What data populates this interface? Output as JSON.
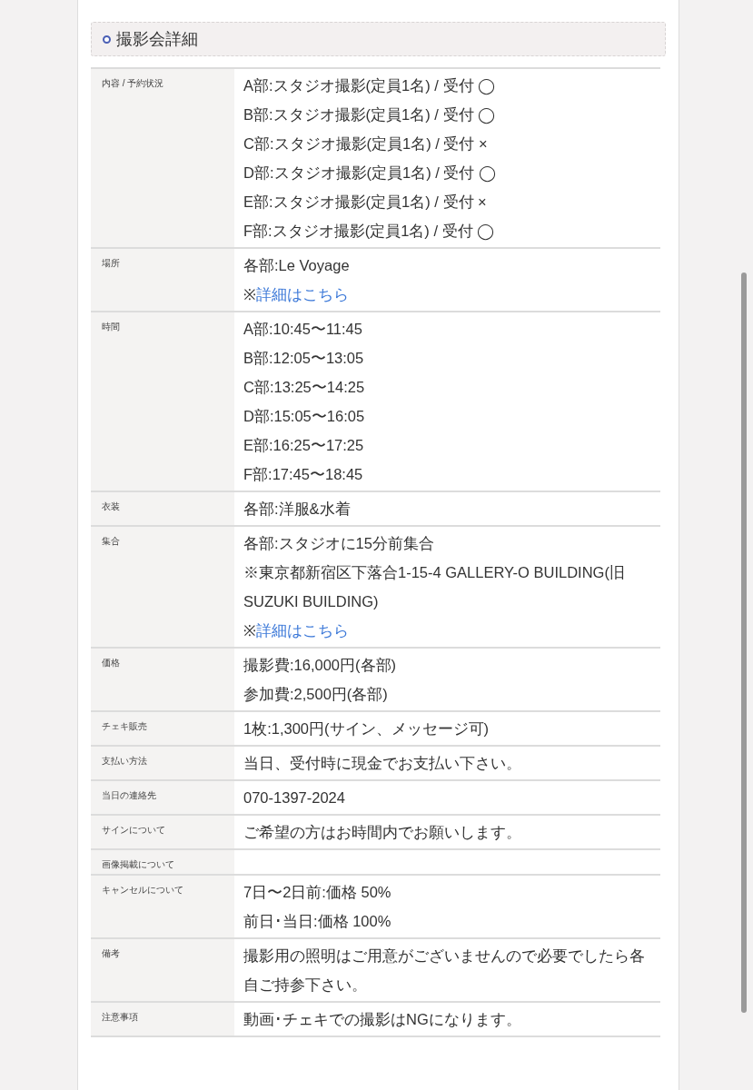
{
  "section": {
    "title": "撮影会詳細"
  },
  "rows": [
    {
      "label": "内容 / 予約状況",
      "lines": [
        {
          "kind": "text",
          "text": "A部:スタジオ撮影(定員1名) / 受付 ◯"
        },
        {
          "kind": "text",
          "text": "B部:スタジオ撮影(定員1名) / 受付 ◯"
        },
        {
          "kind": "text",
          "text": "C部:スタジオ撮影(定員1名) / 受付 ×"
        },
        {
          "kind": "text",
          "text": "D部:スタジオ撮影(定員1名) / 受付 ◯"
        },
        {
          "kind": "text",
          "text": "E部:スタジオ撮影(定員1名) / 受付 ×"
        },
        {
          "kind": "text",
          "text": "F部:スタジオ撮影(定員1名) / 受付 ◯"
        }
      ]
    },
    {
      "label": "場所",
      "lines": [
        {
          "kind": "text",
          "text": "各部:Le Voyage"
        },
        {
          "kind": "link",
          "prefix": "※",
          "text": "詳細はこちら"
        }
      ]
    },
    {
      "label": "時間",
      "lines": [
        {
          "kind": "text",
          "text": "A部:10:45〜11:45"
        },
        {
          "kind": "text",
          "text": "B部:12:05〜13:05"
        },
        {
          "kind": "text",
          "text": "C部:13:25〜14:25"
        },
        {
          "kind": "text",
          "text": "D部:15:05〜16:05"
        },
        {
          "kind": "text",
          "text": "E部:16:25〜17:25"
        },
        {
          "kind": "text",
          "text": "F部:17:45〜18:45"
        }
      ]
    },
    {
      "label": "衣装",
      "lines": [
        {
          "kind": "text",
          "text": "各部:洋服&水着"
        }
      ]
    },
    {
      "label": "集合",
      "lines": [
        {
          "kind": "text",
          "text": "各部:スタジオに15分前集合"
        },
        {
          "kind": "text",
          "text": "※東京都新宿区下落合1-15-4 GALLERY-O BUILDING(旧SUZUKI BUILDING)"
        },
        {
          "kind": "link",
          "prefix": "※",
          "text": "詳細はこちら"
        }
      ]
    },
    {
      "label": "価格",
      "lines": [
        {
          "kind": "text",
          "text": "撮影費:16,000円(各部)"
        },
        {
          "kind": "text",
          "text": "参加費:2,500円(各部)"
        }
      ]
    },
    {
      "label": "チェキ販売",
      "lines": [
        {
          "kind": "text",
          "text": "1枚:1,300円(サイン、メッセージ可)"
        }
      ]
    },
    {
      "label": "支払い方法",
      "lines": [
        {
          "kind": "text",
          "text": "当日、受付時に現金でお支払い下さい。"
        }
      ]
    },
    {
      "label": "当日の連絡先",
      "lines": [
        {
          "kind": "text",
          "text": "070-1397-2024"
        }
      ]
    },
    {
      "label": "サインについて",
      "lines": [
        {
          "kind": "text",
          "text": "ご希望の方はお時間内でお願いします。"
        }
      ]
    },
    {
      "label": "画像掲載について"
    },
    {
      "label": "キャンセルについて",
      "lines": [
        {
          "kind": "text",
          "text": "7日〜2日前:価格 50%"
        },
        {
          "kind": "text",
          "text": "前日･当日:価格 100%"
        }
      ]
    },
    {
      "label": "備考",
      "lines": [
        {
          "kind": "text",
          "text": "撮影用の照明はご用意がございませんので必要でしたら各自ご持参下さい。"
        }
      ]
    },
    {
      "label": "注意事項",
      "lines": [
        {
          "kind": "text",
          "text": "動画･チェキでの撮影はNGになります。"
        }
      ]
    }
  ]
}
